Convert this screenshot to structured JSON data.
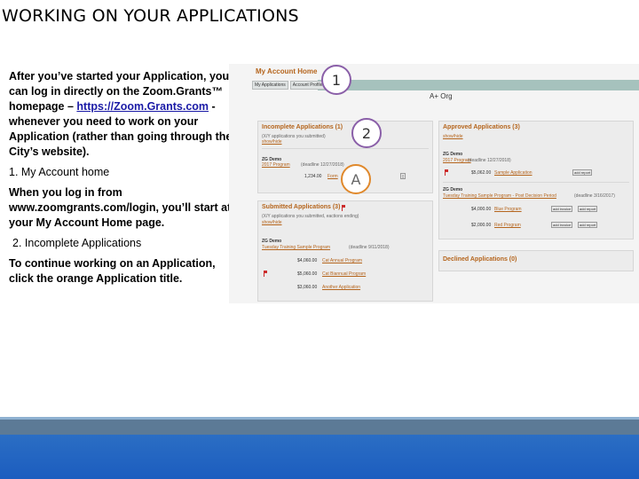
{
  "slide": {
    "title": "WORKING ON YOUR APPLICATIONS",
    "para1_pre": "After you’ve started your Application, you can log in directly on the Zoom.Grants™ homepage – ",
    "para1_link": "https://Zoom.Grants.com",
    "para1_post": " - whenever you need to work on your Application (rather than going through the City’s website).",
    "item1": "1. My Account home",
    "para2": "When you log in from www.zoomgrants.com/login, you’ll start at your My Account Home page.",
    "item2": "2. Incomplete Applications",
    "para3": "To continue working on an Application, click the orange Application title."
  },
  "screenshot": {
    "my_account_home": "My Account Home",
    "tabs": [
      "My Applications",
      "Account Profile"
    ],
    "org": "A+ Org",
    "incomplete": {
      "title": "Incomplete Applications (1)",
      "sub": "(X/Y applications you submitted)",
      "show_hide": "show/hide",
      "group": "ZG Demo",
      "program": "2017 Program",
      "deadline": "(deadline 12/27/2018)",
      "amount": "1,234.00",
      "app_link": "Form"
    },
    "submitted": {
      "title": "Submitted Applications (3)",
      "sub": "(X/Y applications you submitted, eactions ending)",
      "show_hide": "show/hide",
      "group": "ZG Demo",
      "program": "Tuesday Training Sample Program",
      "deadline": "(deadline 9/11/2018)",
      "rows": [
        {
          "amount": "$4,060.00",
          "label": "Cat Annual Program"
        },
        {
          "amount": "$5,060.00",
          "label": "Cat Biannual Program"
        },
        {
          "amount": "$3,060.00",
          "label": "Another Application"
        }
      ]
    },
    "approved": {
      "title": "Approved Applications (3)",
      "show_hide": "show/hide",
      "group1": "ZG Demo",
      "program1": "2017 Program",
      "deadline1": "(deadline 12/27/2018)",
      "row1_amount": "$5,062.00",
      "row1_label": "Sample Application",
      "group2": "ZG Demo",
      "program2": "Tuesday Training Sample Program - Post Decision Period",
      "deadline2": "(deadline 3/16/2017)",
      "row2_amount": "$4,000.00",
      "row2_label": "Blue Program",
      "row3_amount": "$2,000.00",
      "row3_label": "Red Program",
      "btn_invoice": "add invoice",
      "btn_report": "add report"
    },
    "declined": {
      "title": "Declined Applications (0)"
    }
  },
  "badges": {
    "one": "1",
    "two": "2",
    "a": "A"
  },
  "colors": {
    "accent_orange": "#b5651d",
    "badge_purple": "#8a5fa8",
    "badge_orange": "#e0892c",
    "footer_blue": "#1c5dbf"
  }
}
